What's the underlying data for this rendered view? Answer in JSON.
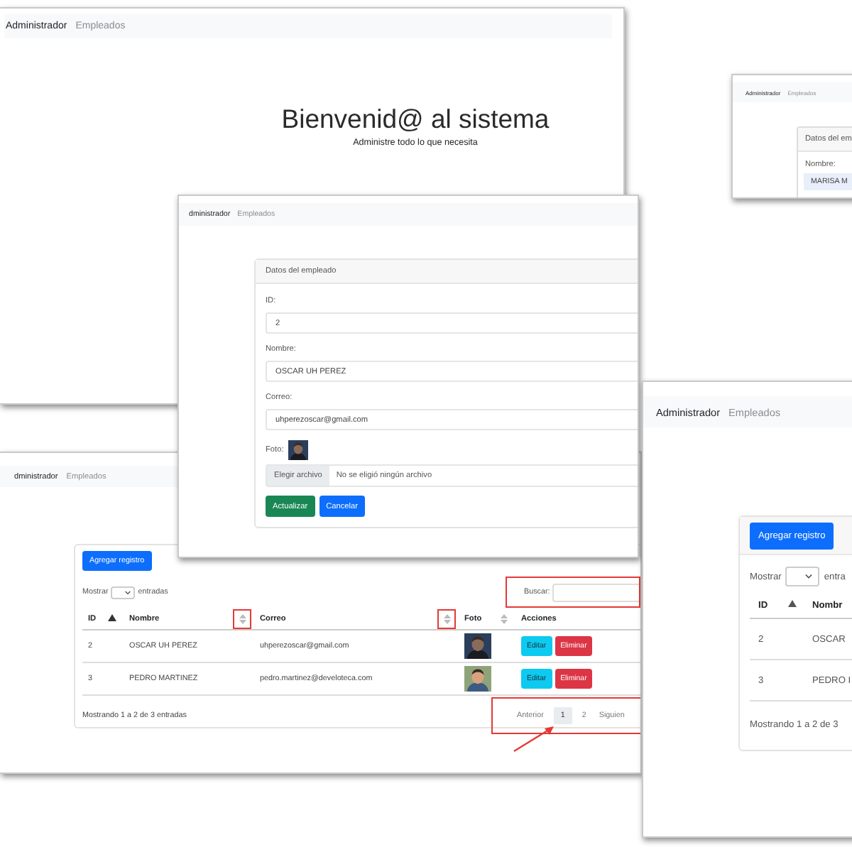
{
  "home_window": {
    "nav": {
      "brand": "Administrador",
      "link": "Empleados"
    },
    "title": "Bienvenid@ al sistema",
    "subtitle": "Administre todo lo que necesita"
  },
  "back_form_window": {
    "nav": {
      "brand": "Administrador",
      "link": "Empleados"
    },
    "card_title": "Datos del em",
    "fields": [
      {
        "label": "Nombre:",
        "value": "MARISA M"
      }
    ]
  },
  "list_window": {
    "nav": {
      "brand": "dministrador",
      "link": "Empleados"
    },
    "add_button": "Agregar registro",
    "length_label": "Mostrar",
    "length_suffix": "entradas",
    "search": {
      "label": "Buscar:",
      "highlighted": true
    },
    "columns": [
      {
        "label": "ID",
        "sortable": true,
        "sorted": true
      },
      {
        "label": "Nombre",
        "sortable": true,
        "sorted": false,
        "highlighted": true
      },
      {
        "label": "Correo",
        "sortable": true,
        "sorted": false,
        "highlighted": true
      },
      {
        "label": "Foto",
        "sortable": true,
        "sorted": false
      },
      {
        "label": "Acciones",
        "sortable": false
      }
    ],
    "rows": [
      {
        "cells": [
          "2",
          "OSCAR UH PEREZ",
          "uhperezoscar@gmail.com"
        ],
        "photo": {
          "kind": "picture"
        },
        "actions": [
          {
            "label": "Editar",
            "kind": "edit"
          },
          {
            "label": "Eliminar",
            "kind": "delete"
          }
        ]
      },
      {
        "cells": [
          "3",
          "PEDRO MARTINEZ",
          "pedro.martinez@develoteca.com"
        ],
        "photo": {
          "kind": "picture"
        },
        "actions": [
          {
            "label": "Editar",
            "kind": "edit"
          },
          {
            "label": "Eliminar",
            "kind": "delete"
          }
        ]
      }
    ],
    "info": "Mostrando 1 a 2 de 3 entradas",
    "pagination_highlighted": true,
    "pagination": [
      {
        "label": "Anterior",
        "selected": false
      },
      {
        "label": "1",
        "selected": true
      },
      {
        "label": "2",
        "selected": false
      },
      {
        "label": "Siguien",
        "selected": false
      }
    ]
  },
  "form_window": {
    "nav": {
      "brand": "dministrador",
      "link": "Empleados"
    },
    "card_title": "Datos del empleado",
    "fields": [
      {
        "label": "ID:",
        "value": "2"
      },
      {
        "label": "Nombre:",
        "value": "OSCAR UH PEREZ"
      },
      {
        "label": "Correo:",
        "value": "uhperezoscar@gmail.com"
      }
    ],
    "photo_label": "Foto:",
    "photo": {
      "kind": "picture"
    },
    "file_button": "Elegir archivo",
    "file_status": "No se eligió ningún archivo",
    "buttons": [
      {
        "label": "Actualizar",
        "kind": "success"
      },
      {
        "label": "Cancelar",
        "kind": "primary"
      }
    ]
  },
  "narrow_list_window": {
    "nav": {
      "brand": "Administrador",
      "link": "Empleados"
    },
    "add_button": "Agregar registro",
    "length_label": "Mostrar",
    "length_suffix": "entra",
    "columns": [
      {
        "label": "ID",
        "sortable": true,
        "sorted": true
      },
      {
        "label": "Nombr"
      }
    ],
    "rows": [
      {
        "cells": [
          "2",
          "OSCAR"
        ]
      },
      {
        "cells": [
          "3",
          "PEDRO I"
        ]
      }
    ],
    "info": "Mostrando 1 a 2 de 3"
  }
}
